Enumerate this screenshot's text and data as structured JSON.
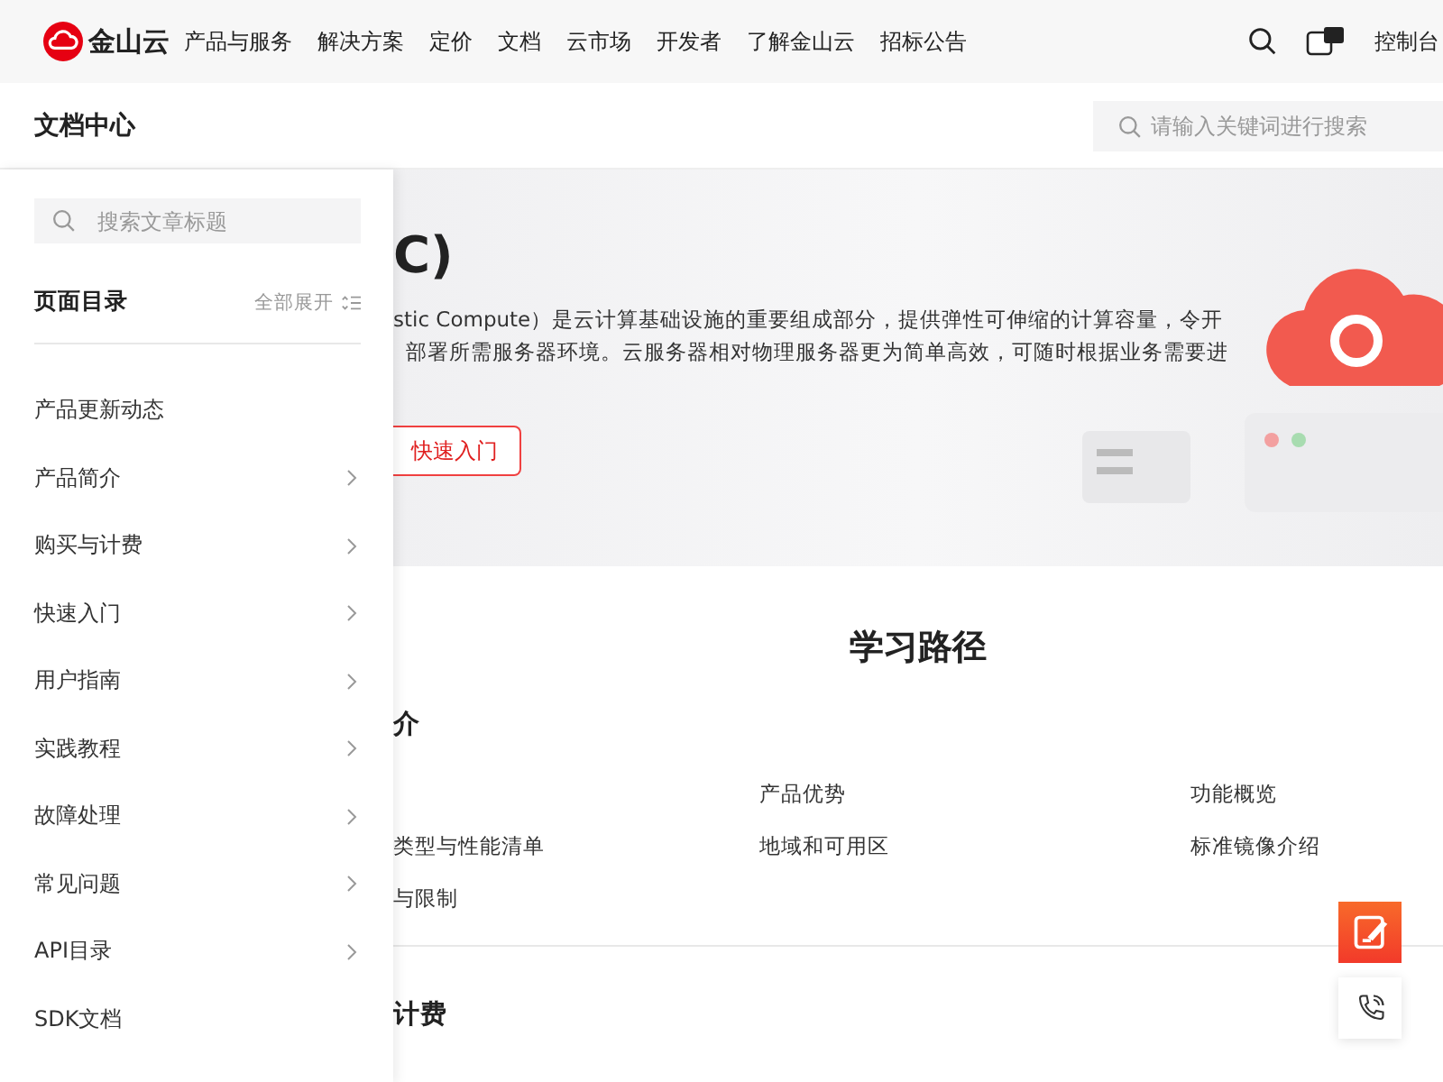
{
  "top_nav": {
    "brand": "金山云",
    "menu": [
      "产品与服务",
      "解决方案",
      "定价",
      "文档",
      "云市场",
      "开发者",
      "了解金山云",
      "招标公告"
    ],
    "console": "控制台"
  },
  "sub_header": {
    "title": "文档中心",
    "search": {
      "placeholder": "请输入关键词进行搜索"
    }
  },
  "sidebar": {
    "search": {
      "placeholder": "搜索文章标题"
    },
    "heading": "页面目录",
    "expand_all": "全部展开",
    "items": [
      {
        "label": "产品更新动态",
        "expandable": false
      },
      {
        "label": "产品简介",
        "expandable": true
      },
      {
        "label": "购买与计费",
        "expandable": true
      },
      {
        "label": "快速入门",
        "expandable": true
      },
      {
        "label": "用户指南",
        "expandable": true
      },
      {
        "label": "实践教程",
        "expandable": true
      },
      {
        "label": "故障处理",
        "expandable": true
      },
      {
        "label": "常见问题",
        "expandable": true
      },
      {
        "label": "API目录",
        "expandable": true
      },
      {
        "label": "SDK文档",
        "expandable": false
      }
    ]
  },
  "hero": {
    "title": "C)",
    "description": [
      "stic Compute）是云计算基础设施的重要组成部分，提供弹性可伸缩的计算容量，令开",
      "部署所需服务器环境。云服务器相对物理服务器更为简单高效，可随时根据业务需要进"
    ],
    "button": "快速入门"
  },
  "learning_path": {
    "title": "学习路径",
    "sections": [
      {
        "heading": "介",
        "links": [
          "产品优势",
          "功能概览",
          "类型与性能清单",
          "地域和可用区",
          "标准镜像介绍",
          "与限制"
        ]
      },
      {
        "heading": "计费"
      }
    ]
  }
}
